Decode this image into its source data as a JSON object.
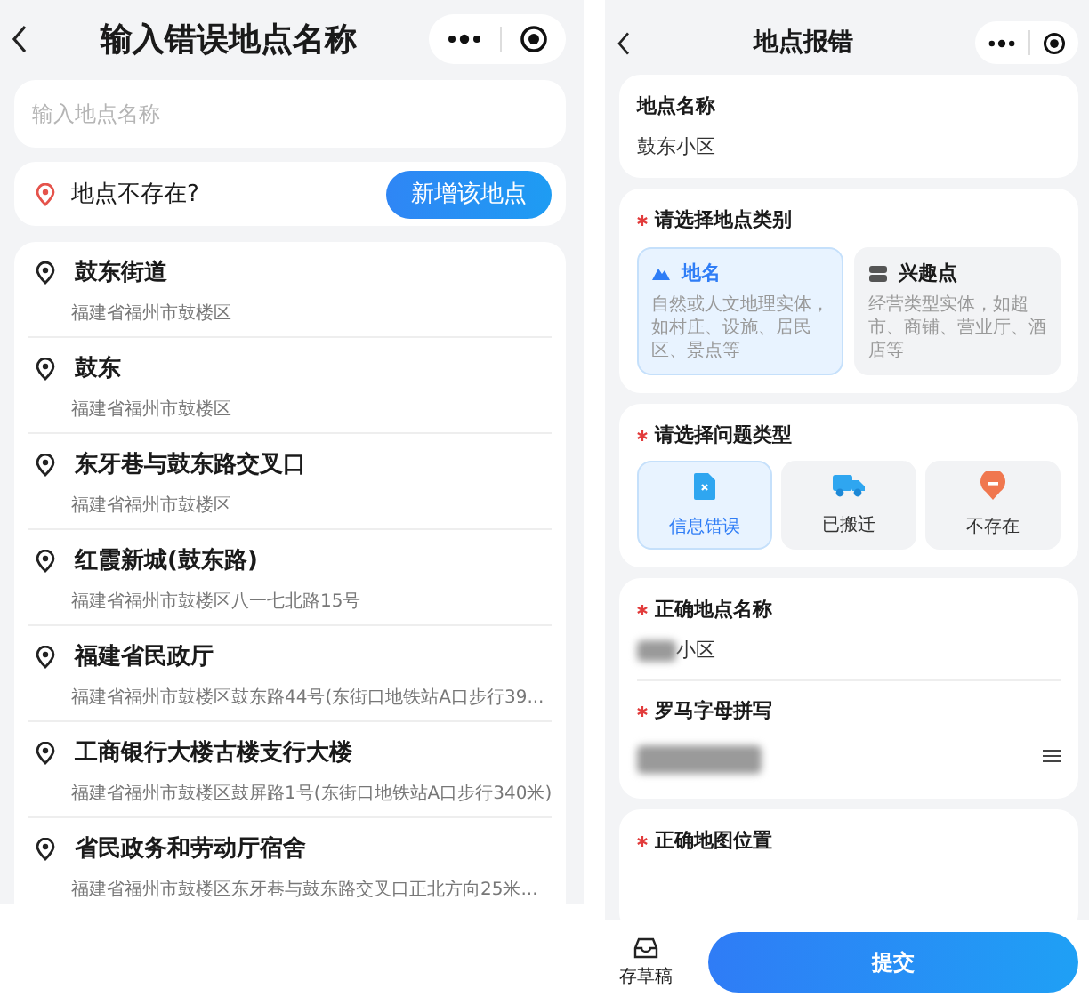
{
  "left": {
    "title": "输入错误地点名称",
    "search": {
      "placeholder": "输入地点名称"
    },
    "not_found": {
      "text": "地点不存在?",
      "button": "新增该地点"
    },
    "results": [
      {
        "name": "鼓东街道",
        "address": "福建省福州市鼓楼区"
      },
      {
        "name": "鼓东",
        "address": "福建省福州市鼓楼区"
      },
      {
        "name": "东牙巷与鼓东路交叉口",
        "address": "福建省福州市鼓楼区"
      },
      {
        "name": "红霞新城(鼓东路)",
        "address": "福建省福州市鼓楼区八一七北路15号"
      },
      {
        "name": "福建省民政厅",
        "address": "福建省福州市鼓楼区鼓东路44号(东街口地铁站A口步行39..."
      },
      {
        "name": "工商银行大楼古楼支行大楼",
        "address": "福建省福州市鼓楼区鼓屏路1号(东街口地铁站A口步行340米)"
      },
      {
        "name": "省民政务和劳动厅宿舍",
        "address": "福建省福州市鼓楼区东牙巷与鼓东路交叉口正北方向25米..."
      }
    ]
  },
  "right": {
    "title": "地点报错",
    "place_name": {
      "label": "地点名称",
      "value": "鼓东小区",
      "required": false
    },
    "category": {
      "label": "请选择地点类别",
      "required": true,
      "options": [
        {
          "name": "地名",
          "description": "自然或人文地理实体，如村庄、设施、居民区、景点等",
          "selected": true
        },
        {
          "name": "兴趣点",
          "description": "经营类型实体，如超市、商铺、营业厅、酒店等",
          "selected": false
        }
      ]
    },
    "problem_type": {
      "label": "请选择问题类型",
      "required": true,
      "options": [
        {
          "label": "信息错误",
          "selected": true
        },
        {
          "label": "已搬迁",
          "selected": false
        },
        {
          "label": "不存在",
          "selected": false
        }
      ]
    },
    "correct_name": {
      "label": "正确地点名称",
      "value": "小区",
      "required": true
    },
    "roman_spelling": {
      "label": "罗马字母拼写",
      "required": true
    },
    "map_location": {
      "label": "正确地图位置",
      "required": true
    },
    "bottom": {
      "draft": "存草稿",
      "submit": "提交"
    }
  }
}
